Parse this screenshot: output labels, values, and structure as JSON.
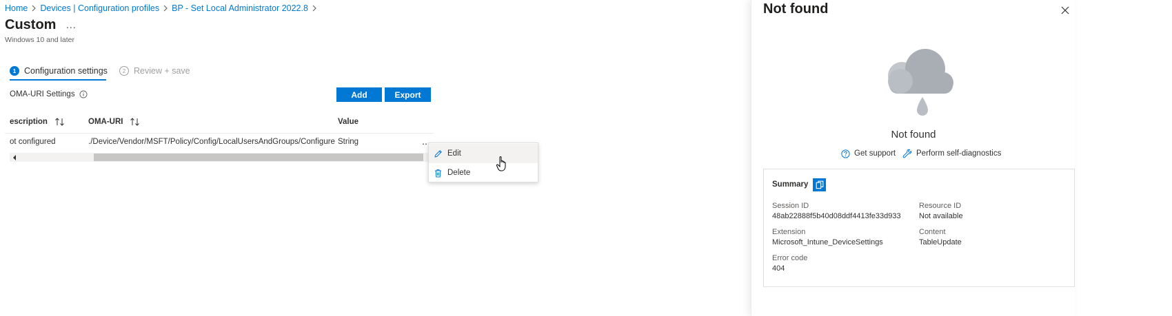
{
  "breadcrumb": [
    {
      "label": "Home"
    },
    {
      "label": "Devices | Configuration profiles"
    },
    {
      "label": "BP - Set Local Administrator 2022.8"
    }
  ],
  "page": {
    "title": "Custom",
    "more": "...",
    "subtitle": "Windows 10 and later"
  },
  "steps": [
    {
      "number": "1",
      "label": "Configuration settings"
    },
    {
      "number": "2",
      "label": "Review + save"
    }
  ],
  "oma_settings": {
    "label": "OMA-URI Settings",
    "add_label": "Add",
    "export_label": "Export"
  },
  "table": {
    "columns": [
      "escription",
      "OMA-URI",
      "Value"
    ],
    "rows": [
      {
        "description": "ot configured",
        "oma_uri": "./Device/Vendor/MSFT/Policy/Config/LocalUsersAndGroups/Configure",
        "value": "String",
        "more": "..."
      }
    ]
  },
  "context_menu": {
    "items": [
      {
        "label": "Edit",
        "icon": "pencil-icon"
      },
      {
        "label": "Delete",
        "icon": "trash-icon"
      }
    ]
  },
  "panel": {
    "title": "Not found",
    "message": "Not found",
    "links": {
      "support": "Get support",
      "diagnostics": "Perform self-diagnostics"
    },
    "summary": {
      "title": "Summary",
      "fields": {
        "session_id": {
          "label": "Session ID",
          "value": "48ab22888f5b40d08ddf4413fe33d933"
        },
        "resource_id": {
          "label": "Resource ID",
          "value": "Not available"
        },
        "extension": {
          "label": "Extension",
          "value": "Microsoft_Intune_DeviceSettings"
        },
        "content": {
          "label": "Content",
          "value": "TableUpdate"
        },
        "error_code": {
          "label": "Error code",
          "value": "404"
        }
      }
    }
  },
  "colors": {
    "accent": "#0078d4",
    "cloud": "#a9aeb5",
    "cloud_dark": "#b9bec5"
  }
}
